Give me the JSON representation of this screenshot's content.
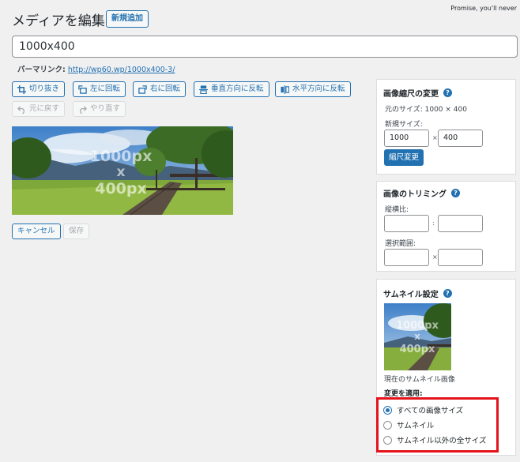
{
  "top_note": "Promise, you'll never",
  "page_title": "メディアを編集",
  "add_new_label": "新規追加",
  "title_value": "1000x400",
  "permalink": {
    "label": "パーマリンク:",
    "url": "http://wp60.wp/1000x400-3/"
  },
  "toolbar": {
    "crop": "切り抜き",
    "rotate_left": "左に回転",
    "rotate_right": "右に回転",
    "flip_vertical": "垂直方向に反転",
    "flip_horizontal": "水平方向に反転",
    "undo": "元に戻す",
    "redo": "やり直す"
  },
  "image": {
    "overlay_line1": "1000px",
    "overlay_line2": "x",
    "overlay_line3": "400px"
  },
  "actions": {
    "cancel": "キャンセル",
    "save": "保存"
  },
  "scale_panel": {
    "title": "画像縮尺の変更",
    "help": "?",
    "original_size": "元のサイズ: 1000 × 400",
    "new_size_label": "新規サイズ:",
    "width": "1000",
    "separator": "×",
    "height": "400",
    "scale_button": "縮尺変更"
  },
  "crop_panel": {
    "title": "画像のトリミング",
    "help": "?",
    "aspect_label": "縦横比:",
    "aspect_separator": ":",
    "selection_label": "選択範囲:",
    "selection_separator": "×"
  },
  "thumb_panel": {
    "title": "サムネイル設定",
    "help": "?",
    "current_thumb": "現在のサムネイル画像",
    "apply_label": "変更を適用:",
    "options": [
      {
        "label": "すべての画像サイズ",
        "checked": true
      },
      {
        "label": "サムネイル",
        "checked": false
      },
      {
        "label": "サムネイル以外の全サイズ",
        "checked": false
      }
    ]
  },
  "colors": {
    "accent": "#2271b1",
    "highlight": "#e5131c"
  }
}
